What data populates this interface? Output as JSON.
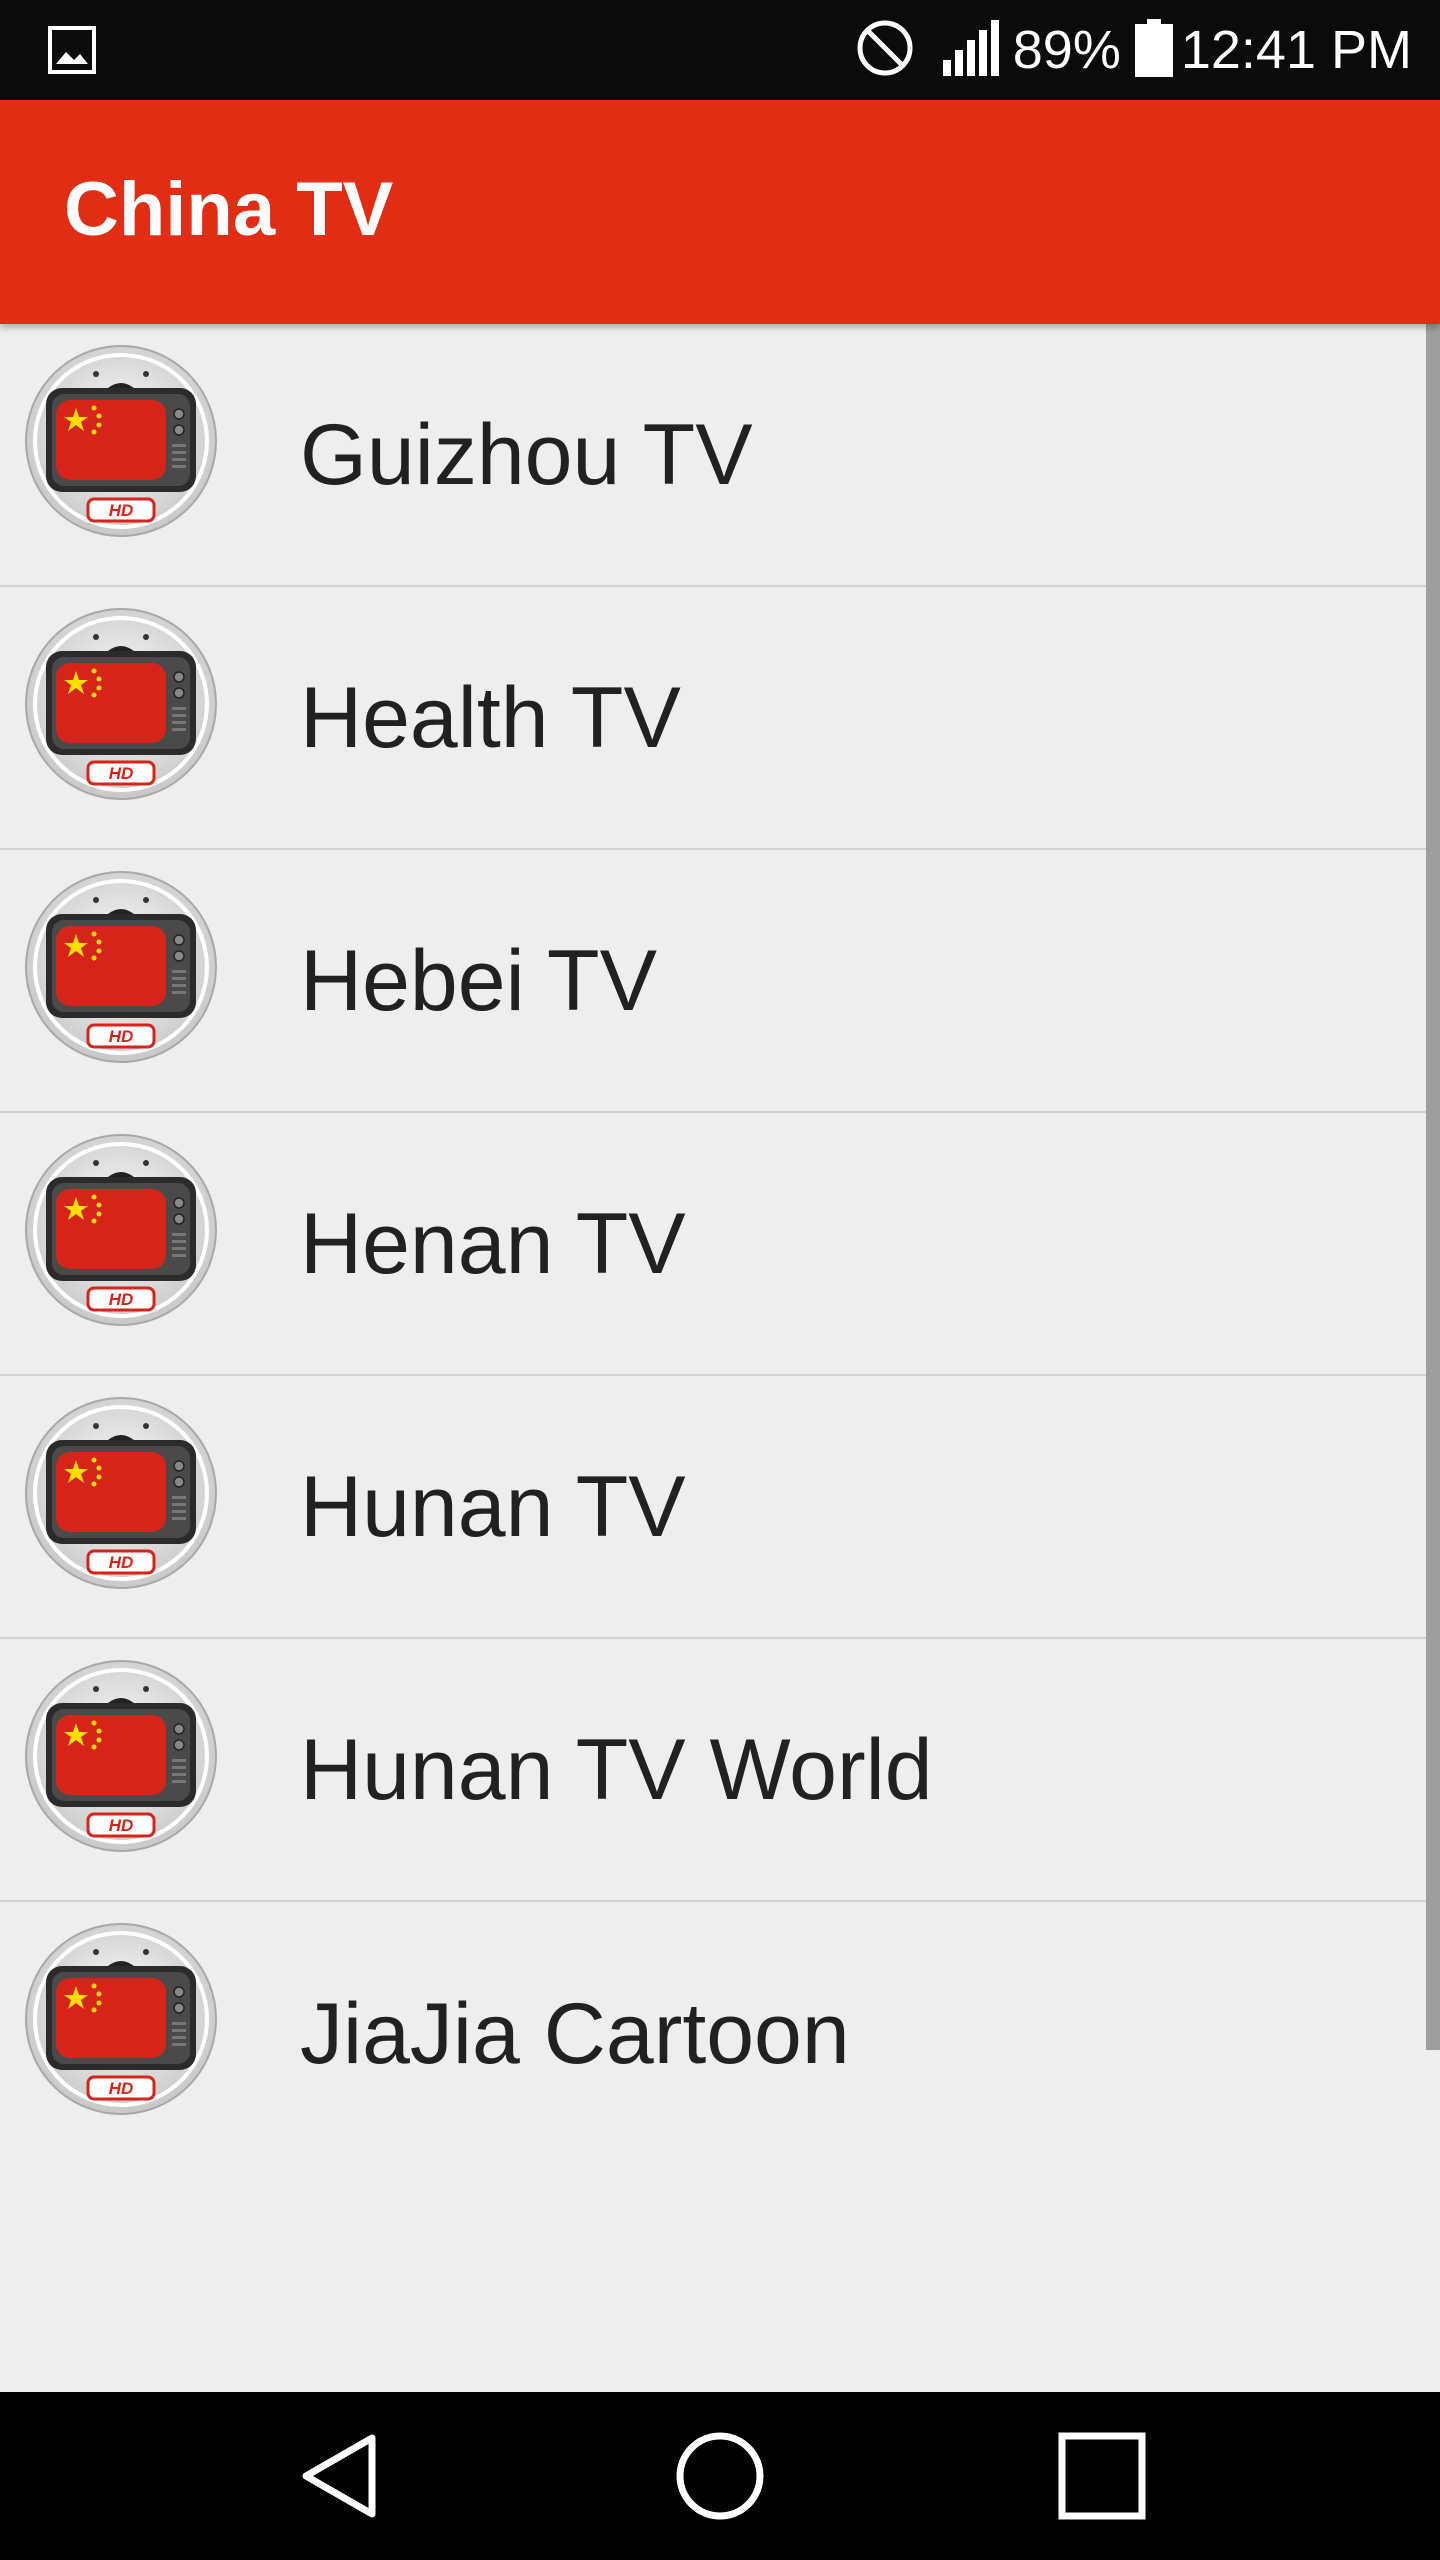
{
  "status_bar": {
    "left_icon": "image-icon",
    "dnd_icon": "do-not-disturb-icon",
    "signal_icon": "signal-icon",
    "battery_percent": "89%",
    "battery_icon": "battery-icon",
    "time": "12:41 PM"
  },
  "app_bar": {
    "title": "China TV",
    "color": "#e02d14"
  },
  "channels": [
    {
      "name": "Guizhou TV",
      "icon": "tv-hd-china-flag-icon"
    },
    {
      "name": "Health TV",
      "icon": "tv-hd-china-flag-icon"
    },
    {
      "name": "Hebei TV",
      "icon": "tv-hd-china-flag-icon"
    },
    {
      "name": "Henan TV",
      "icon": "tv-hd-china-flag-icon"
    },
    {
      "name": "Hunan TV",
      "icon": "tv-hd-china-flag-icon"
    },
    {
      "name": "Hunan TV World",
      "icon": "tv-hd-china-flag-icon"
    },
    {
      "name": "JiaJia Cartoon",
      "icon": "tv-hd-china-flag-icon"
    }
  ],
  "thumb_badge": "HD",
  "nav_bar": {
    "back_icon": "back-icon",
    "home_icon": "home-icon",
    "recents_icon": "recents-icon"
  }
}
